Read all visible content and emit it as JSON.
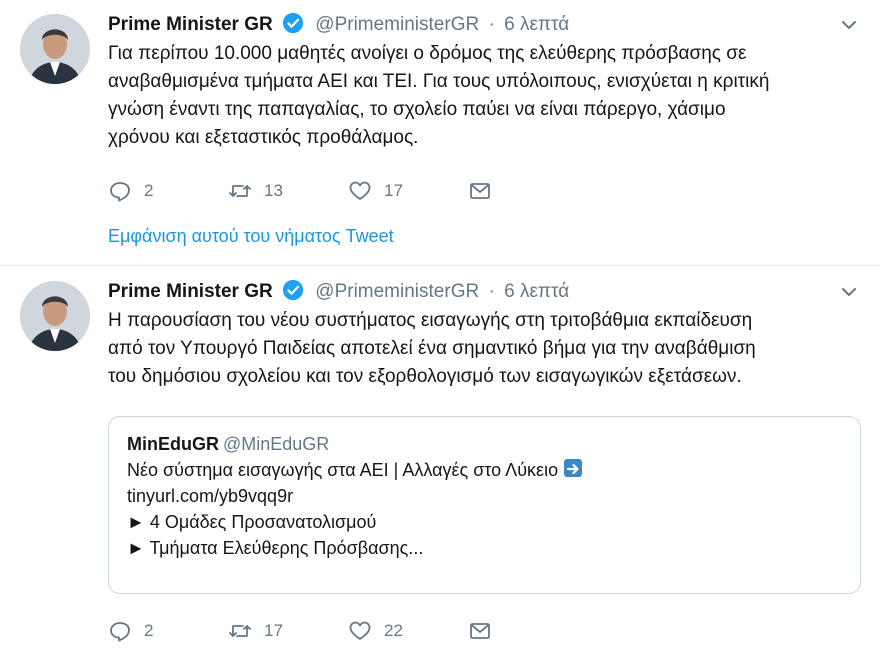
{
  "tweets": [
    {
      "author_name": "Prime Minister GR",
      "handle": "@PrimeministerGR",
      "separator": "·",
      "time": "6 λεπτά",
      "text_lines": [
        "Για περίπου 10.000 μαθητές ανοίγει ο δρόμος της ελεύθερης πρόσβασης σε",
        "αναβαθμισμένα τμήματα ΑΕΙ και ΤΕΙ. Για τους υπόλοιπους, ενισχύεται η κριτική",
        "γνώση έναντι της παπαγαλίας, το σχολείο παύει να είναι πάρεργο, χάσιμο",
        "χρόνου και εξεταστικός προθάλαμος."
      ],
      "replies": "2",
      "retweets": "13",
      "likes": "17",
      "thread_link": "Εμφάνιση αυτού του νήματος Tweet"
    },
    {
      "author_name": "Prime Minister GR",
      "handle": "@PrimeministerGR",
      "separator": "·",
      "time": "6 λεπτά",
      "text_lines": [
        "Η παρουσίαση του νέου συστήματος εισαγωγής στη τριτοβάθμια εκπαίδευση",
        "από τον Υπουργό Παιδείας αποτελεί ένα σημαντικό βήμα για την αναβάθμιση",
        "του δημόσιου σχολείου και τον εξορθολογισμό των εισαγωγικών εξετάσεων."
      ],
      "quote": {
        "name": "MinEduGR",
        "handle": "@MinEduGR",
        "line1": "Νέο σύστημα εισαγωγής στα ΑΕΙ | Αλλαγές στο Λύκειο",
        "line2": "tinyurl.com/yb9vqq9r",
        "line3": "► 4 Ομάδες Προσανατολισμού",
        "line4": "► Τμήματα Ελεύθερης Πρόσβασης..."
      },
      "replies": "2",
      "retweets": "17",
      "likes": "22"
    }
  ],
  "colors": {
    "link": "#1b95e0",
    "verified": "#1da1f2",
    "muted": "#657786"
  }
}
